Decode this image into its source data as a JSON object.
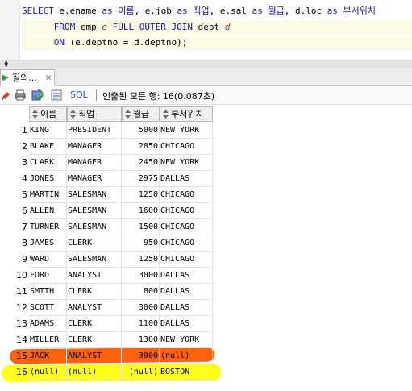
{
  "editor": {
    "line1": {
      "select": "SELECT",
      "rest": " e.ename ",
      "as1": "as",
      "alias1": " 이름",
      "c1": ", e.job ",
      "as2": "as",
      "alias2": " 직업",
      "c2": ", e.sal ",
      "as3": "as",
      "alias3": " 월급",
      "c3": ", d.loc ",
      "as4": "as",
      "alias4": " 부서위치"
    },
    "line2": {
      "from": "FROM",
      "tbl1": " emp ",
      "a1": "e",
      "join": " FULL OUTER JOIN",
      "tbl2": " dept ",
      "a2": "d"
    },
    "line3": {
      "on": "ON",
      "cond": " (e.deptno = d.deptno);"
    }
  },
  "tab": {
    "label": "질의...",
    "close": "×"
  },
  "toolbar": {
    "sql_label": "SQL",
    "status": "인출된 모든 행: 16(0.087초)"
  },
  "grid": {
    "columns": [
      "이름",
      "직업",
      "월급",
      "부서위치"
    ],
    "rows": [
      {
        "n": "1",
        "name": "KING",
        "job": "PRESIDENT",
        "sal": "5000",
        "loc": "NEW YORK"
      },
      {
        "n": "2",
        "name": "BLAKE",
        "job": "MANAGER",
        "sal": "2850",
        "loc": "CHICAGO"
      },
      {
        "n": "3",
        "name": "CLARK",
        "job": "MANAGER",
        "sal": "2450",
        "loc": "NEW YORK"
      },
      {
        "n": "4",
        "name": "JONES",
        "job": "MANAGER",
        "sal": "2975",
        "loc": "DALLAS"
      },
      {
        "n": "5",
        "name": "MARTIN",
        "job": "SALESMAN",
        "sal": "1250",
        "loc": "CHICAGO"
      },
      {
        "n": "6",
        "name": "ALLEN",
        "job": "SALESMAN",
        "sal": "1600",
        "loc": "CHICAGO"
      },
      {
        "n": "7",
        "name": "TURNER",
        "job": "SALESMAN",
        "sal": "1500",
        "loc": "CHICAGO"
      },
      {
        "n": "8",
        "name": "JAMES",
        "job": "CLERK",
        "sal": "950",
        "loc": "CHICAGO"
      },
      {
        "n": "9",
        "name": "WARD",
        "job": "SALESMAN",
        "sal": "1250",
        "loc": "CHICAGO"
      },
      {
        "n": "10",
        "name": "FORD",
        "job": "ANALYST",
        "sal": "3000",
        "loc": "DALLAS"
      },
      {
        "n": "11",
        "name": "SMITH",
        "job": "CLERK",
        "sal": "800",
        "loc": "DALLAS"
      },
      {
        "n": "12",
        "name": "SCOTT",
        "job": "ANALYST",
        "sal": "3000",
        "loc": "DALLAS"
      },
      {
        "n": "13",
        "name": "ADAMS",
        "job": "CLERK",
        "sal": "1100",
        "loc": "DALLAS"
      },
      {
        "n": "14",
        "name": "MILLER",
        "job": "CLERK",
        "sal": "1300",
        "loc": "NEW YORK"
      },
      {
        "n": "15",
        "name": "JACK",
        "job": "ANALYST",
        "sal": "3000",
        "loc": "(null)"
      },
      {
        "n": "16",
        "name": "(null)",
        "job": "(null)",
        "sal": "(null)",
        "loc": "BOSTON"
      }
    ]
  },
  "highlights": {
    "row15_color": "#ff5a00",
    "row16_color": "#ffff00"
  }
}
